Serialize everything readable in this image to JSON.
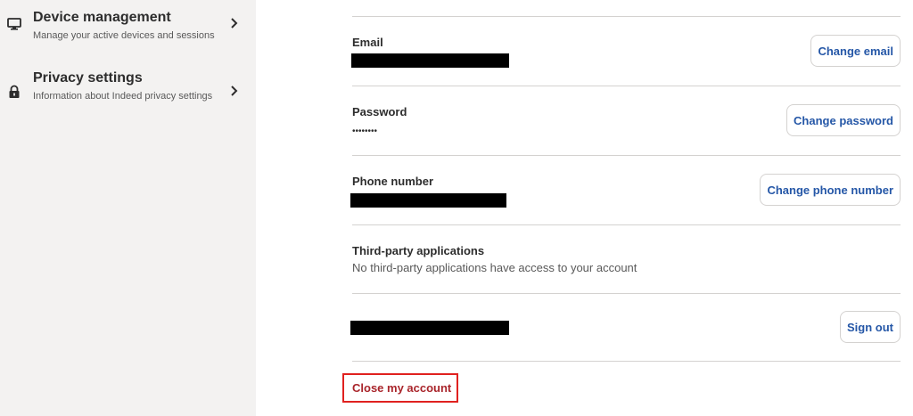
{
  "sidebar": {
    "items": [
      {
        "title": "Device management",
        "description": "Manage your active devices and sessions",
        "icon": "monitor-icon"
      },
      {
        "title": "Privacy settings",
        "description": "Information about Indeed privacy settings",
        "icon": "lock-icon"
      }
    ]
  },
  "account": {
    "email": {
      "label": "Email",
      "button": "Change email"
    },
    "password": {
      "label": "Password",
      "value": "••••••••",
      "button": "Change password"
    },
    "phone": {
      "label": "Phone number",
      "button": "Change phone number"
    },
    "third_party": {
      "label": "Third-party applications",
      "text": "No third-party applications have access to your account"
    },
    "session": {
      "button": "Sign out"
    },
    "close_account": "Close my account"
  },
  "colors": {
    "link": "#2557a7",
    "danger": "#a9252b",
    "highlight_border": "#e0211f",
    "sidebar_bg": "#f3f2f1"
  }
}
